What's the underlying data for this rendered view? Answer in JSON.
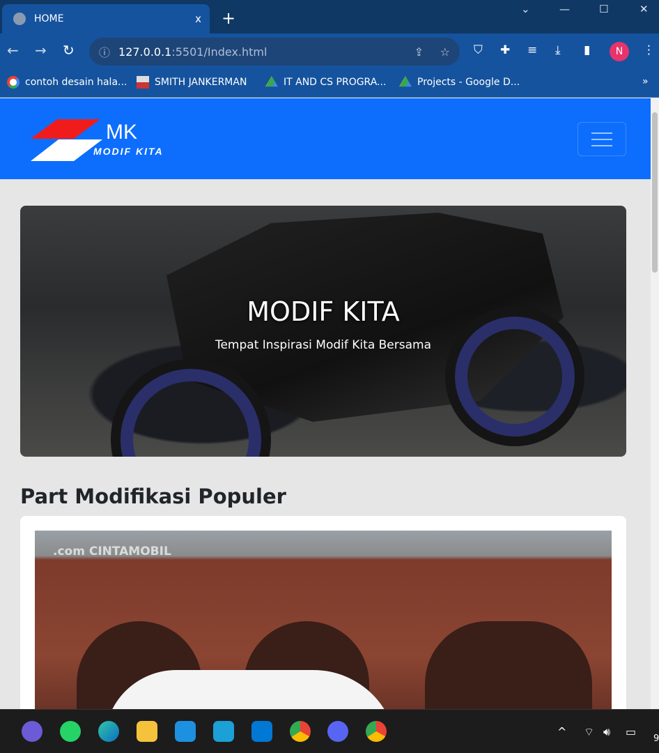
{
  "browser": {
    "tab_title": "HOME",
    "tab_close": "x",
    "new_tab": "+",
    "window_controls": {
      "dropdown": "⌄",
      "minimize": "—",
      "maximize": "☐",
      "close": "✕"
    },
    "url_host": "127.0.0.1",
    "url_rest": ":5501/Index.html",
    "profile_initial": "N",
    "bookmarks": [
      {
        "label": "contoh desain hala...",
        "icon": "google-icon"
      },
      {
        "label": "SMITH JANKERMAN",
        "icon": "image-icon"
      },
      {
        "label": "IT AND CS PROGRA...",
        "icon": "google-drive-icon"
      },
      {
        "label": "Projects - Google D...",
        "icon": "google-drive-icon"
      }
    ],
    "bookmarks_more": "»"
  },
  "site": {
    "logo_text": "MK",
    "logo_sub": "MODIF KITA",
    "hero_title": "MODIF KITA",
    "hero_subtitle": "Tempat Inspirasi Modif Kita Bersama",
    "section_title": "Part Modifikasi Populer",
    "card_watermark": ".com CINTAMOBIL",
    "brand_color": "#0d6efd"
  },
  "taskbar": {
    "apps": [
      "teams",
      "whatsapp",
      "edge",
      "file-explorer",
      "mail",
      "lexis",
      "vscode",
      "chrome",
      "discord",
      "chrome-profile"
    ],
    "clock_partial": "9"
  }
}
